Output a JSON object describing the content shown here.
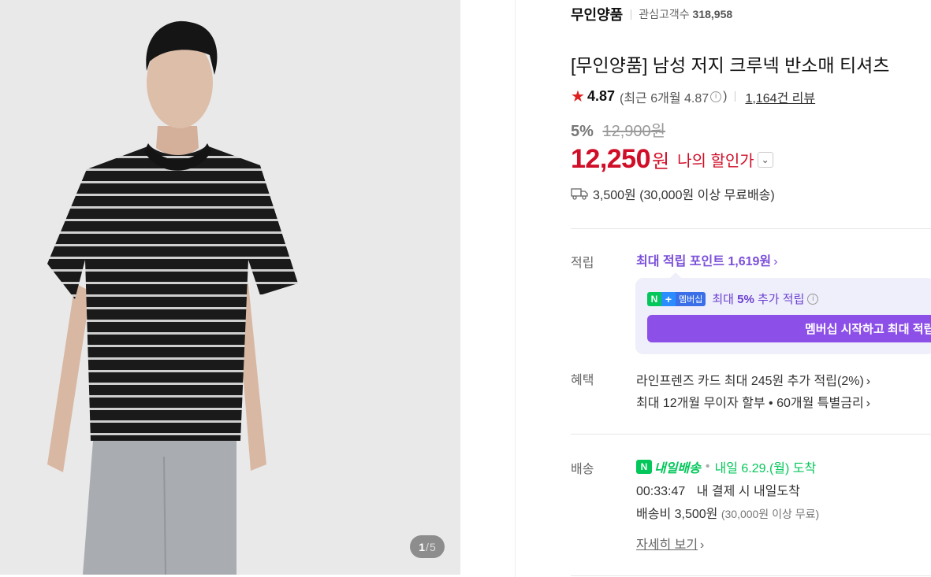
{
  "gallery": {
    "current": "1",
    "separator": "/",
    "total": "5"
  },
  "store": {
    "name": "무인양품",
    "fans_label": "관심고객수",
    "fans_count": "318,958"
  },
  "product": {
    "title": "[무인양품] 남성 저지 크루넥 반소매 티셔츠",
    "rating": "4.87",
    "recent_rating": "(최근 6개월 4.87",
    "recent_close": ")",
    "review_count": "1,164건 리뷰",
    "discount_percent": "5%",
    "original_price": "12,900원",
    "price": "12,250",
    "price_unit": "원",
    "my_discount_label": "나의 할인가",
    "shipping_summary": "3,500원 (30,000원 이상 무료배송)"
  },
  "points": {
    "label": "적립",
    "max_points": "최대 적립 포인트 1,619원",
    "membership_badge": {
      "n": "N",
      "plus": "+",
      "text": "멤버십"
    },
    "membership_text_prefix": "최대 ",
    "membership_text_bold": "5%",
    "membership_text_suffix": " 추가 적립",
    "cta": "멤버십 시작하고 최대 적립"
  },
  "benefits": {
    "label": "혜택",
    "items": [
      "라인프렌즈 카드 최대 245원 추가 적립(2%)",
      "최대 12개월 무이자 할부 • 60개월 특별금리"
    ]
  },
  "delivery": {
    "label": "배송",
    "badge_n": "N",
    "badge_text": "내일배송",
    "dot": "•",
    "arrival": "내일 6.29.(월) 도착",
    "timer": "00:33:47",
    "deadline_text": "내 결제 시 내일도착",
    "fee": "배송비 3,500원",
    "fee_condition": "(30,000원 이상 무료)",
    "detail_link": "자세히 보기"
  },
  "colors": {
    "price_red": "#d00e28",
    "points_purple": "#7b4fd9",
    "naver_green": "#03c75a"
  }
}
